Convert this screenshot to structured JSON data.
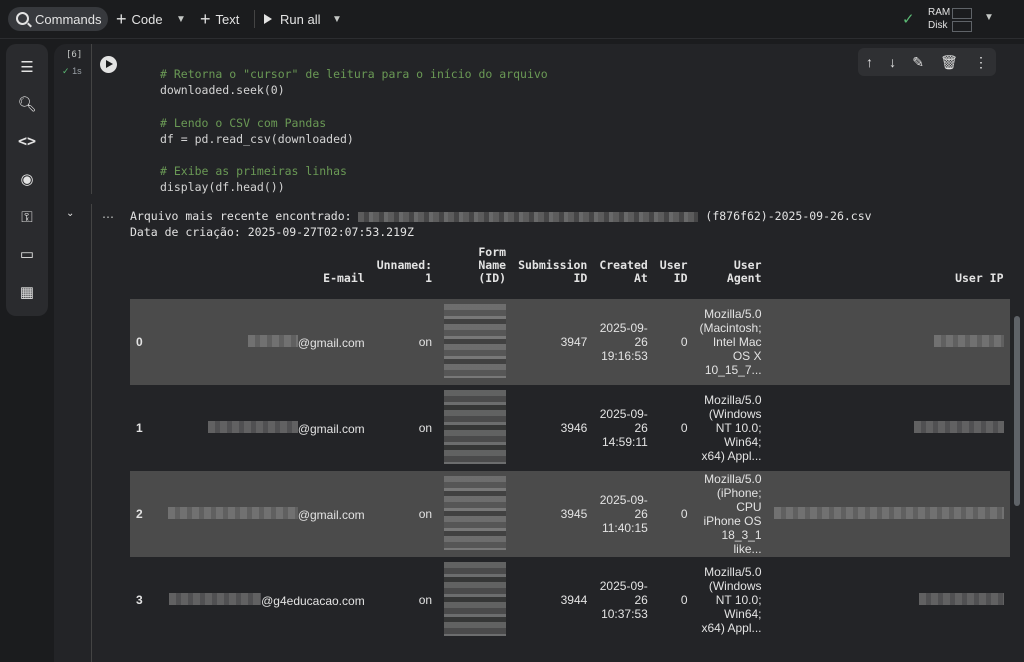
{
  "toolbar": {
    "commands_label": "Commands",
    "code_label": "Code",
    "text_label": "Text",
    "run_all_label": "Run all",
    "ram_label": "RAM",
    "disk_label": "Disk"
  },
  "sidebar": {
    "icons": [
      "toc-icon",
      "find-icon",
      "code-snippets-icon",
      "variables-icon",
      "secrets-icon",
      "files-icon",
      "data-table-icon"
    ]
  },
  "cell": {
    "exec_count": "[6]",
    "exec_time": "1s",
    "code_lines": [
      {
        "type": "comment",
        "text": "# Retorna o \"cursor\" de leitura para o início do arquivo"
      },
      {
        "type": "code",
        "text": "downloaded.seek(0)"
      },
      {
        "type": "blank",
        "text": ""
      },
      {
        "type": "comment",
        "text": "# Lendo o CSV com Pandas"
      },
      {
        "type": "code",
        "text": "df = pd.read_csv(downloaded)"
      },
      {
        "type": "blank",
        "text": ""
      },
      {
        "type": "comment",
        "text": "# Exibe as primeiras linhas"
      },
      {
        "type": "code",
        "text": "display(df.head())"
      }
    ]
  },
  "output": {
    "line1_prefix": "Arquivo mais recente encontrado: ",
    "line1_suffix": " (f876f62)-2025-09-26.csv",
    "line2": "Data de criação: 2025-09-27T02:07:53.219Z",
    "table": {
      "headers": [
        "",
        "E-mail",
        "Unnamed:\n1",
        "Form\nName\n(ID)",
        "Submission\nID",
        "Created\nAt",
        "User\nID",
        "User\nAgent",
        "User IP"
      ],
      "rows": [
        {
          "idx": "0",
          "email": "@gmail.com",
          "unnamed": "on",
          "submission": "3947",
          "created": "2025-09-\n26\n19:16:53",
          "user_id": "0",
          "agent": "Mozilla/5.0\n(Macintosh;\nIntel Mac\nOS X\n10_15_7..."
        },
        {
          "idx": "1",
          "email": "@gmail.com",
          "unnamed": "on",
          "submission": "3946",
          "created": "2025-09-\n26\n14:59:11",
          "user_id": "0",
          "agent": "Mozilla/5.0\n(Windows\nNT 10.0;\nWin64;\nx64) Appl..."
        },
        {
          "idx": "2",
          "email": "@gmail.com",
          "unnamed": "on",
          "submission": "3945",
          "created": "2025-09-\n26\n11:40:15",
          "user_id": "0",
          "agent": "Mozilla/5.0\n(iPhone;\nCPU\niPhone OS\n18_3_1\nlike..."
        },
        {
          "idx": "3",
          "email": "@g4educacao.com",
          "unnamed": "on",
          "submission": "3944",
          "created": "2025-09-\n26\n10:37:53",
          "user_id": "0",
          "agent": "Mozilla/5.0\n(Windows\nNT 10.0;\nWin64;\nx64) Appl..."
        }
      ]
    }
  }
}
